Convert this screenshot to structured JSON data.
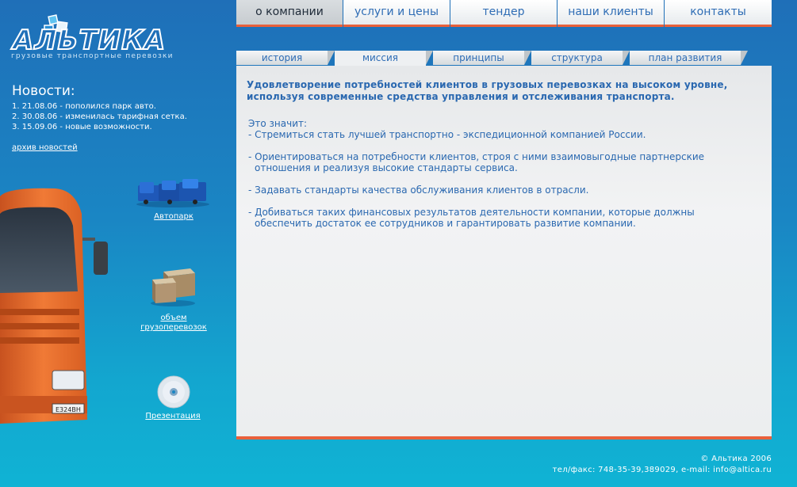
{
  "logo": {
    "wordmark": "АЛЬТИКА",
    "tagline": "грузовые транспортные перевозки"
  },
  "nav": {
    "items": [
      {
        "label": "о компании"
      },
      {
        "label": "услуги и цены"
      },
      {
        "label": "тендер"
      },
      {
        "label": "наши клиенты"
      },
      {
        "label": "контакты"
      }
    ],
    "active_index": 0
  },
  "subnav": {
    "items": [
      {
        "label": "история"
      },
      {
        "label": "миссия"
      },
      {
        "label": "принципы"
      },
      {
        "label": "структура"
      },
      {
        "label": "план развития"
      }
    ],
    "active_index": 1
  },
  "news": {
    "title": "Новости:",
    "items": [
      {
        "text": "1. 21.08.06 - пополился парк авто."
      },
      {
        "text": "2. 30.08.06 - изменилась тарифная сетка."
      },
      {
        "text": "3. 15.09.06 - новые возможности."
      }
    ],
    "archive_label": "архив новостей"
  },
  "side_links": {
    "fleet": "Автопарк",
    "volume_line1": "объем",
    "volume_line2": "грузоперевозок",
    "presentation": "Презентация"
  },
  "truck_plate": "Е324ВН",
  "content": {
    "lead": "Удовлетворение потребностей клиентов в грузовых перевозках на высоком уровне, используя современные средства управления и отслеживания транспорта.",
    "intro": "Это значит:",
    "p1": "- Стремиться стать лучшей транспортно - экспедиционной компанией России.",
    "p2_line1": "- Ориентироваться на потребности клиентов, строя с ними взаимовыгодные партнерские",
    "p2_line2": "отношения и реализуя высокие стандарты сервиса.",
    "p3": "- Задавать стандарты качества обслуживания клиентов в отрасли.",
    "p4_line1": "- Добиваться таких финансовых результатов деятельности компании, которые должны",
    "p4_line2": "обеспечить достаток ее сотрудников и гарантировать развитие компании."
  },
  "footer": {
    "copyright": "© Альтика 2006",
    "contacts": "тел/факс: 748-35-39,389029, e-mail: info@altica.ru"
  },
  "colors": {
    "accent": "#e8603b",
    "link_blue": "#2f6db5",
    "bg_top": "#1f6fb8",
    "bg_bottom": "#10b3d4"
  }
}
